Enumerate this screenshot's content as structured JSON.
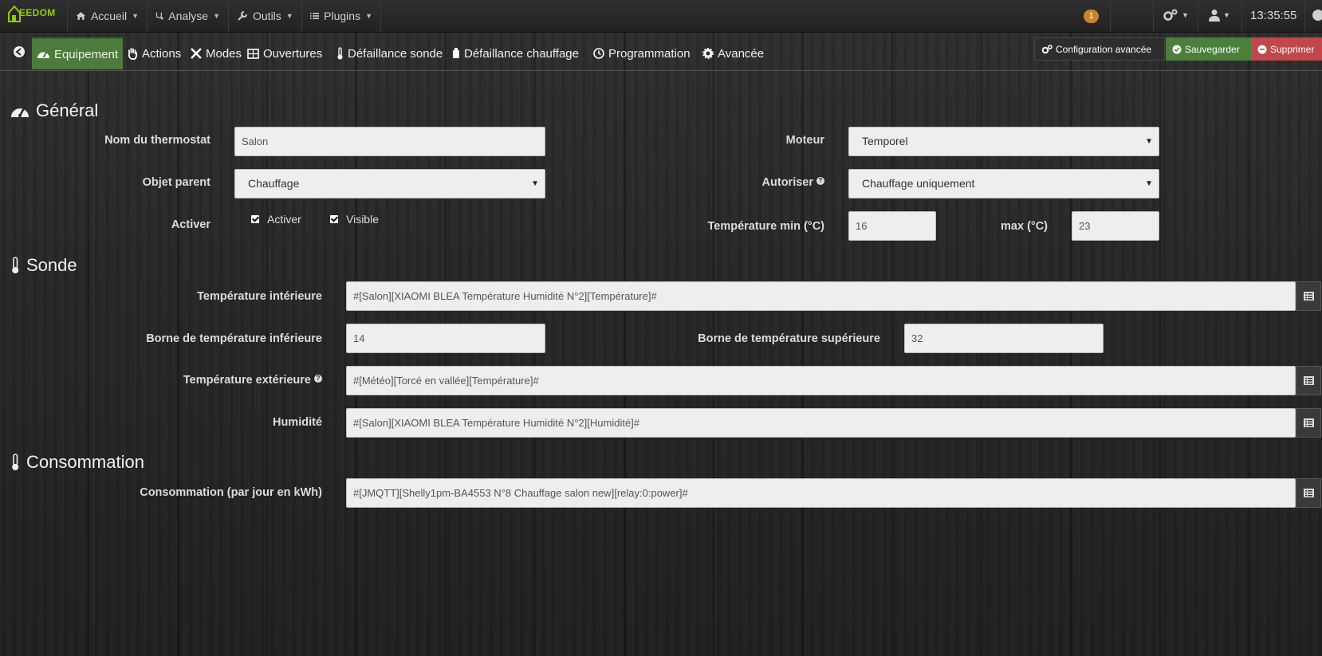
{
  "navbar": {
    "logo_text": "EEDOM",
    "items": [
      {
        "label": "Accueil"
      },
      {
        "label": "Analyse"
      },
      {
        "label": "Outils"
      },
      {
        "label": "Plugins"
      }
    ],
    "notification_count": "1",
    "time": "13:35:55"
  },
  "tabs": [
    {
      "label": "Equipement",
      "icon": "tachometer-icon",
      "active": true
    },
    {
      "label": "Actions",
      "icon": "hand-icon"
    },
    {
      "label": "Modes",
      "icon": "modes-icon"
    },
    {
      "label": "Ouvertures",
      "icon": "window-icon"
    },
    {
      "label": "Défaillance sonde",
      "icon": "thermometer-icon"
    },
    {
      "label": "Défaillance chauffage",
      "icon": "heater-icon"
    },
    {
      "label": "Programmation",
      "icon": "clock-icon"
    },
    {
      "label": "Avancée",
      "icon": "gear-icon"
    }
  ],
  "actions": {
    "advanced_config": "Configuration avancée",
    "save": "Sauvegarder",
    "delete": "Supprimer"
  },
  "general": {
    "title": "Général",
    "name_label": "Nom du thermostat",
    "name_value": "Salon",
    "parent_label": "Objet parent",
    "parent_value": "Chauffage",
    "activate_label": "Activer",
    "checkbox_activer": "Activer",
    "checkbox_visible": "Visible",
    "engine_label": "Moteur",
    "engine_value": "Temporel",
    "allow_label": "Autoriser",
    "allow_value": "Chauffage uniquement",
    "temp_min_label": "Température min (°C)",
    "temp_min_value": "16",
    "temp_max_label": "max (°C)",
    "temp_max_value": "23"
  },
  "sonde": {
    "title": "Sonde",
    "indoor_label": "Température intérieure",
    "indoor_value": "#[Salon][XIAOMI BLEA Température Humidité N°2][Température]#",
    "lower_label": "Borne de température inférieure",
    "lower_value": "14",
    "upper_label": "Borne de température supérieure",
    "upper_value": "32",
    "outdoor_label": "Température extérieure",
    "outdoor_value": "#[Météo][Torcé en vallée][Température]#",
    "humidity_label": "Humidité",
    "humidity_value": "#[Salon][XIAOMI BLEA Température Humidité N°2][Humidité]#"
  },
  "consommation": {
    "title": "Consommation",
    "label": "Consommation (par jour en kWh)",
    "value": "#[JMQTT][Shelly1pm-BA4553 N°8 Chauffage salon new][relay:0:power]#"
  },
  "colors": {
    "active_tab": "#4c7b3b",
    "save": "#4a7f3c",
    "delete": "#c0484a",
    "badge": "#c8862b",
    "logo": "#94ca02"
  }
}
